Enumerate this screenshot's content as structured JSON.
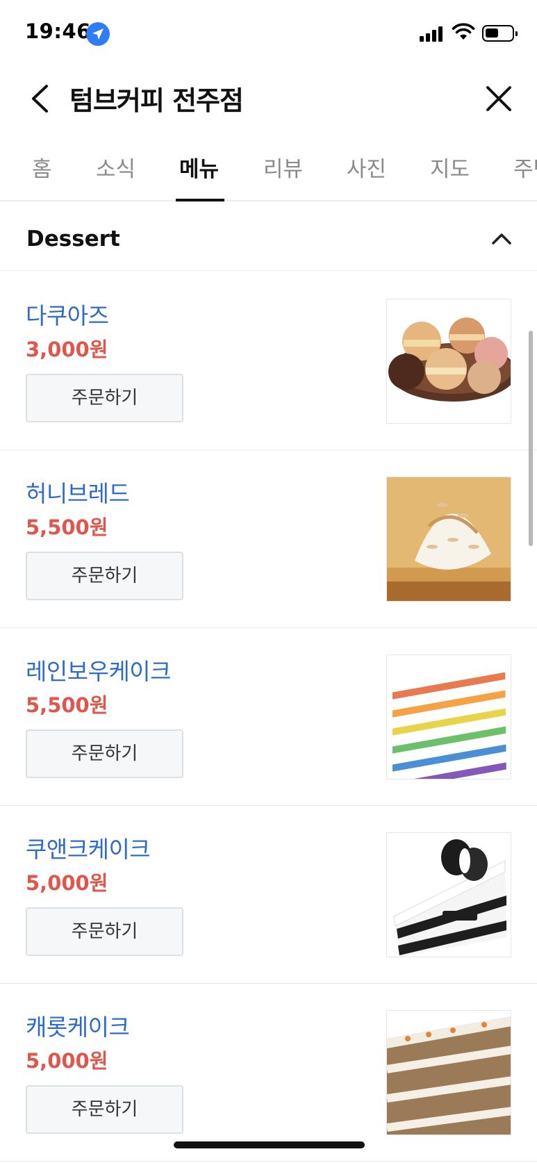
{
  "status_bar": {
    "time": "19:46"
  },
  "header": {
    "title": "텀브커피 전주점"
  },
  "tabs": [
    {
      "label": "홈",
      "active": false
    },
    {
      "label": "소식",
      "active": false
    },
    {
      "label": "메뉴",
      "active": true
    },
    {
      "label": "리뷰",
      "active": false
    },
    {
      "label": "사진",
      "active": false
    },
    {
      "label": "지도",
      "active": false
    },
    {
      "label": "주변",
      "active": false
    }
  ],
  "section": {
    "title": "Dessert"
  },
  "menu_items": [
    {
      "name": "다쿠아즈",
      "price": "3,000원",
      "order_label": "주문하기",
      "image": "macaron-plate"
    },
    {
      "name": "허니브레드",
      "price": "5,500원",
      "order_label": "주문하기",
      "image": "honey-bread"
    },
    {
      "name": "레인보우케이크",
      "price": "5,500원",
      "order_label": "주문하기",
      "image": "rainbow-cake"
    },
    {
      "name": "쿠앤크케이크",
      "price": "5,000원",
      "order_label": "주문하기",
      "image": "oreo-cake"
    },
    {
      "name": "캐롯케이크",
      "price": "5,000원",
      "order_label": "주문하기",
      "image": "carrot-cake"
    }
  ],
  "colors": {
    "item_name": "#2e6bc6",
    "price": "#e0564d",
    "active_tab": "#111111",
    "inactive_tab": "#8a8a8a"
  }
}
